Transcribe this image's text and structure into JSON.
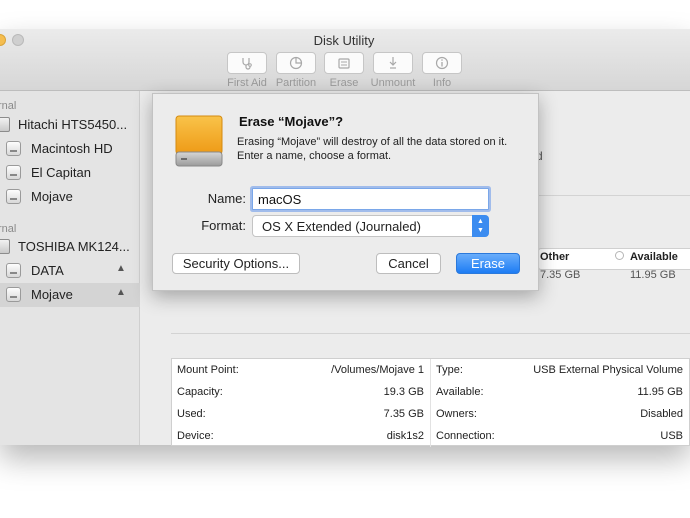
{
  "window": {
    "title": "Disk Utility"
  },
  "toolbar": {
    "items": [
      {
        "label": "First Aid",
        "icon": "stethoscope-icon"
      },
      {
        "label": "Partition",
        "icon": "partition-pie-icon"
      },
      {
        "label": "Erase",
        "icon": "erase-disk-icon"
      },
      {
        "label": "Unmount",
        "icon": "unmount-icon"
      },
      {
        "label": "Info",
        "icon": "info-icon"
      }
    ]
  },
  "sidebar": {
    "sections": [
      {
        "heading": "rnal",
        "items": [
          {
            "label": "Hitachi HTS5450...",
            "kind": "drive"
          },
          {
            "label": "Macintosh HD",
            "kind": "volume"
          },
          {
            "label": "El Capitan",
            "kind": "volume"
          },
          {
            "label": "Mojave",
            "kind": "volume"
          }
        ]
      },
      {
        "heading": "rnal",
        "items": [
          {
            "label": "TOSHIBA MK124...",
            "kind": "drive"
          },
          {
            "label": "DATA",
            "kind": "volume",
            "eject": true
          },
          {
            "label": "Mojave",
            "kind": "volume",
            "eject": true,
            "selected": true
          }
        ]
      }
    ]
  },
  "main": {
    "partial_text": "d",
    "legend": [
      {
        "title": "Other",
        "value": "7.35 GB"
      },
      {
        "title": "Available",
        "value": "11.95 GB"
      }
    ],
    "info_table": {
      "left": [
        {
          "key": "Mount Point:",
          "value": "/Volumes/Mojave 1"
        },
        {
          "key": "Capacity:",
          "value": "19.3 GB"
        },
        {
          "key": "Used:",
          "value": "7.35 GB"
        },
        {
          "key": "Device:",
          "value": "disk1s2"
        }
      ],
      "right": [
        {
          "key": "Type:",
          "value": "USB External Physical Volume"
        },
        {
          "key": "Available:",
          "value": "11.95 GB"
        },
        {
          "key": "Owners:",
          "value": "Disabled"
        },
        {
          "key": "Connection:",
          "value": "USB"
        }
      ]
    }
  },
  "erase_sheet": {
    "title": "Erase “Mojave”?",
    "description": "Erasing “Mojave” will destroy of all the data stored on it. Enter a name, choose a format.",
    "name_label": "Name:",
    "name_value": "macOS",
    "format_label": "Format:",
    "format_value": "OS X Extended (Journaled)",
    "security_button": "Security Options...",
    "cancel_button": "Cancel",
    "erase_button": "Erase"
  },
  "colors": {
    "accent": "#1d7cf4",
    "drive_icon_orange": "#f3a21f"
  }
}
